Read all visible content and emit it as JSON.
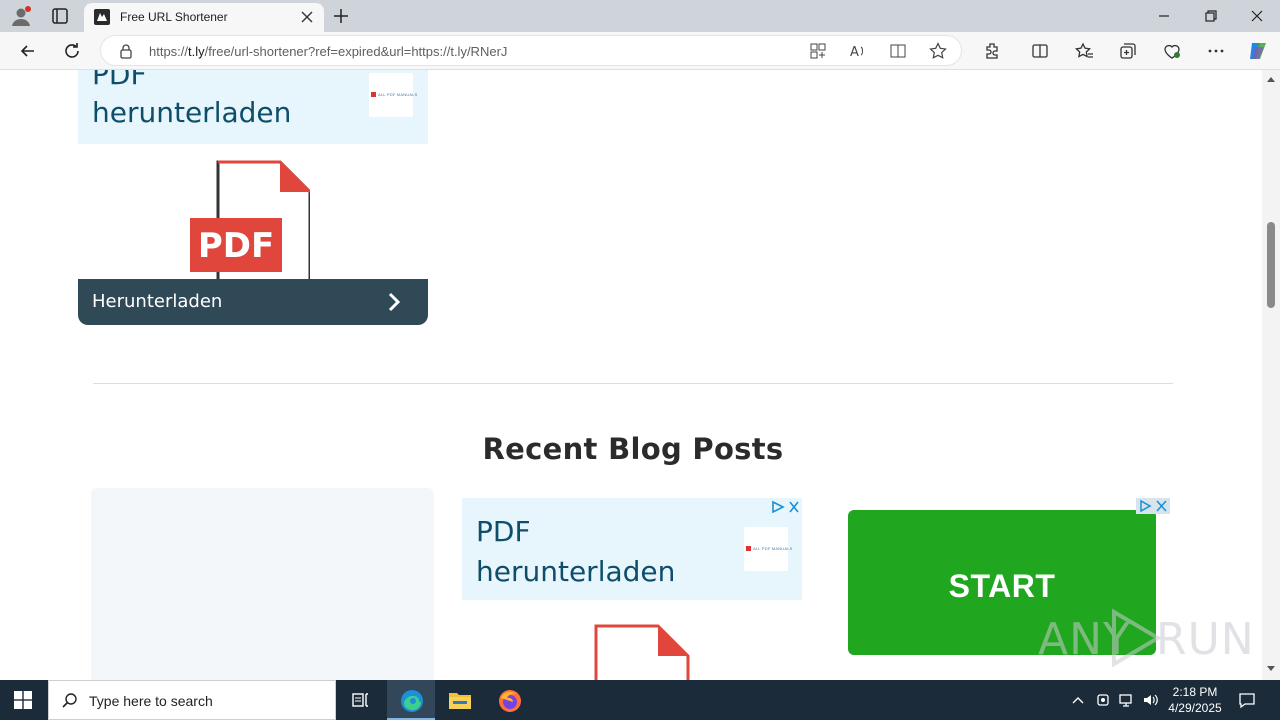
{
  "browser": {
    "tab_title": "Free URL Shortener",
    "url_prefix": "https://",
    "url_host": "t.ly",
    "url_rest": "/free/url-shortener?ref=expired&url=https://t.ly/RNerJ"
  },
  "page": {
    "ad_top": {
      "headline_line1": "PDF",
      "headline_line2": "herunterladen",
      "pdf_label": "PDF",
      "cta_label": "Herunterladen",
      "logo_text": "ALL PDF MANUALS"
    },
    "section_title": "Recent Blog Posts",
    "ad_middle": {
      "headline_line1": "PDF",
      "headline_line2": "herunterladen",
      "logo_text": "ALL PDF MANUALS"
    },
    "ad_right": {
      "button_label": "START"
    },
    "watermark": {
      "text_left": "ANY",
      "text_right": "RUN"
    }
  },
  "taskbar": {
    "search_placeholder": "Type here to search",
    "time": "2:18 PM",
    "date": "4/29/2025"
  },
  "colors": {
    "ad_header_bg": "#e6f6fc",
    "ad_text": "#0f4e6b",
    "pdf_red": "#e0463b",
    "cta_bg": "#2f4a56",
    "start_green": "#21a61f",
    "taskbar_bg": "#1b2b3a"
  },
  "icons": [
    "profile-icon",
    "tab-actions-icon",
    "site-favicon",
    "close-icon",
    "plus-icon",
    "minimize-icon",
    "restore-icon",
    "back-icon",
    "refresh-icon",
    "lock-icon",
    "apps-icon",
    "read-aloud-icon",
    "immersive-reader-icon",
    "favorite-star-icon",
    "extensions-icon",
    "split-screen-icon",
    "favorites-icon",
    "collections-icon",
    "browser-essentials-icon",
    "more-icon",
    "copilot-icon",
    "chevron-right-icon",
    "ad-choices-icon",
    "windows-start-icon",
    "search-icon",
    "task-view-icon",
    "edge-icon",
    "file-explorer-icon",
    "firefox-icon",
    "chevron-up-icon",
    "network-icon",
    "volume-icon",
    "notification-icon"
  ]
}
